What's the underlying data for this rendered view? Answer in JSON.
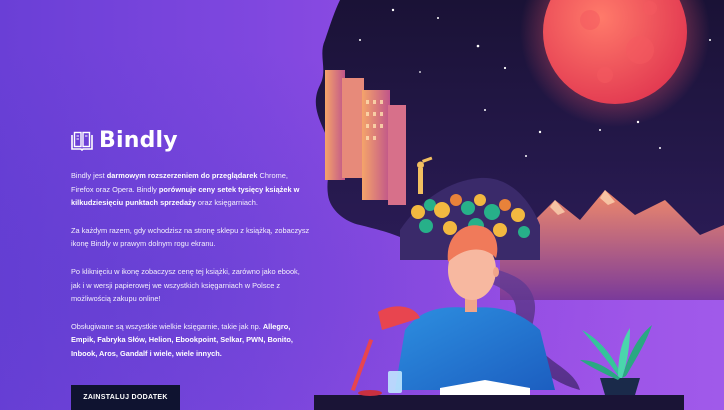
{
  "brand": {
    "name": "Bindly",
    "icon": "book-icon"
  },
  "intro": {
    "t1": "Bindly jest ",
    "b1": "darmowym rozszerzeniem do przeglądarek",
    "t2": " Chrome, Firefox oraz Opera. Bindly ",
    "b2": "porównuje ceny setek tysięcy książek w kilkudziesięciu punktach sprzedaży",
    "t3": " oraz księgarniach."
  },
  "para2": "Za każdym razem, gdy wchodzisz na stronę sklepu z książką, zobaczysz ikonę Bindly w prawym dolnym rogu ekranu.",
  "para3": "Po kliknięciu w ikonę zobaczysz cenę tej książki, zarówno jako ebook, jak i w wersji papierowej we wszystkich księgarniach w Polsce z możliwością zakupu online!",
  "stores": {
    "t1": "Obsługiwane są wszystkie wielkie księgarnie, takie jak np. ",
    "b1": "Allegro, Empik, Fabryka Słów, Helion, Ebookpoint, Selkar, PWN, Bonito, Inbook, Aros, Gandalf i wiele, wiele innych."
  },
  "cta": {
    "label": "ZAINSTALUJ DODATEK"
  },
  "colors": {
    "background": "#7f47df",
    "button": "#0f1330",
    "sky": "#1e1640",
    "moon": "#f04a5a"
  }
}
